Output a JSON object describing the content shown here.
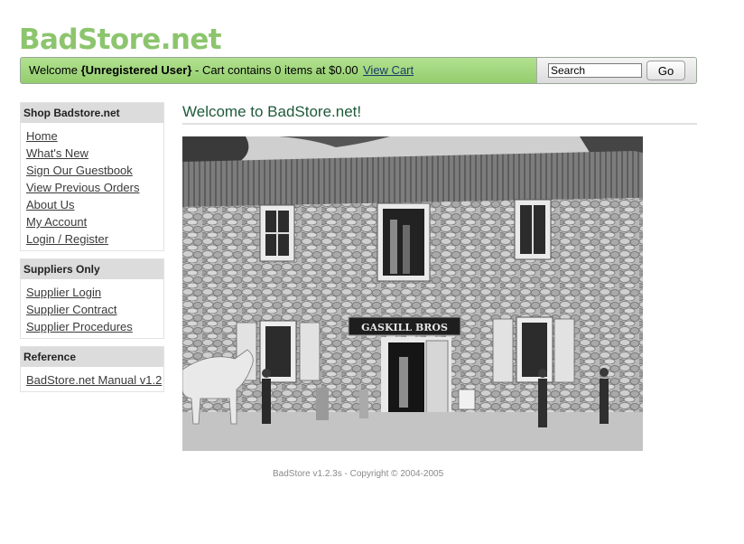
{
  "logo": {
    "text": "BadStore.net"
  },
  "topbar": {
    "welcome_prefix": "Welcome ",
    "user": "{Unregistered User}",
    "cart_text": " - Cart contains 0 items at $0.00",
    "view_cart": "View Cart",
    "search_value": "Search",
    "go_label": "Go"
  },
  "sidebar": {
    "shop": {
      "title": "Shop Badstore.net",
      "items": [
        "Home",
        "What's New",
        "Sign Our Guestbook",
        "View Previous Orders",
        "About Us",
        "My Account",
        "Login / Register"
      ]
    },
    "suppliers": {
      "title": "Suppliers Only",
      "items": [
        "Supplier Login",
        "Supplier Contract",
        "Supplier Procedures"
      ]
    },
    "reference": {
      "title": "Reference",
      "items": [
        "BadStore.net Manual v1.2"
      ]
    }
  },
  "main": {
    "title": "Welcome to BadStore.net!",
    "photo_sign": "GASKILL BROS"
  },
  "footer": {
    "text": "BadStore v1.2.3s - Copyright © 2004-2005"
  },
  "colors": {
    "logo": "#8cc56d",
    "topbar": "#a6d984",
    "title": "#1f5a3a"
  }
}
